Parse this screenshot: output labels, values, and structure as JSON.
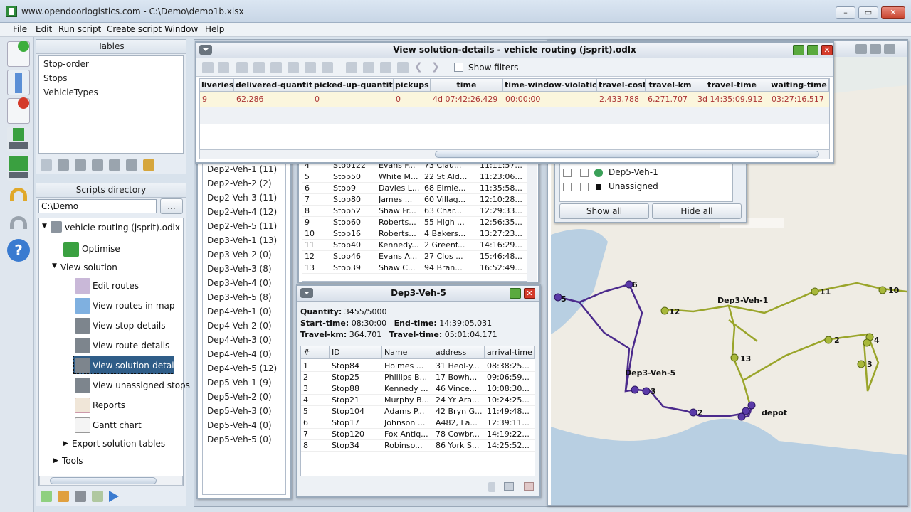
{
  "window": {
    "title": "www.opendoorlogistics.com - C:\\Demo\\demo1b.xlsx",
    "min": "–",
    "max": "▭",
    "close": "✕"
  },
  "menu": [
    "File",
    "Edit",
    "Run script",
    "Create script",
    "Window",
    "Help"
  ],
  "tables_panel": {
    "title": "Tables",
    "items": [
      "Stop-order",
      "Stops",
      "VehicleTypes"
    ]
  },
  "scripts_panel": {
    "title": "Scripts directory",
    "path": "C:\\Demo",
    "browse": "...",
    "root": "vehicle routing (jsprit).odlx",
    "optimise": "Optimise",
    "view_solution": "View solution",
    "items": [
      "Edit routes",
      "View routes in map",
      "View stop-details",
      "View route-details",
      "View solution-details",
      "View unassigned stops",
      "Reports",
      "Gantt chart"
    ],
    "export": "Export solution tables",
    "tools": "Tools"
  },
  "solution_details": {
    "title": "View solution-details - vehicle routing (jsprit).odlx",
    "show_filters": "Show filters",
    "columns": [
      "liveries",
      "delivered-quantity",
      "picked-up-quantity",
      "pickups",
      "time",
      "time-window-violation",
      "travel-cost",
      "travel-km",
      "travel-time",
      "waiting-time"
    ],
    "row": [
      "9",
      "62,286",
      "0",
      "0",
      "4d 07:42:26.429",
      "00:00:00",
      "2,433.788",
      "6,271.707",
      "3d 14:35:09.912",
      "03:27:16.517"
    ]
  },
  "routes_list": [
    "Dep2-Veh-1 (11)",
    "Dep2-Veh-2 (2)",
    "Dep2-Veh-3 (11)",
    "Dep2-Veh-4 (12)",
    "Dep2-Veh-5 (11)",
    "Dep3-Veh-1 (13)",
    "Dep3-Veh-2 (0)",
    "Dep3-Veh-3 (8)",
    "Dep3-Veh-4 (0)",
    "Dep3-Veh-5 (8)",
    "Dep4-Veh-1 (0)",
    "Dep4-Veh-2 (0)",
    "Dep4-Veh-3 (0)",
    "Dep4-Veh-4 (0)",
    "Dep4-Veh-5 (12)",
    "Dep5-Veh-1 (9)",
    "Dep5-Veh-2 (0)",
    "Dep5-Veh-3 (0)",
    "Dep5-Veh-4 (0)",
    "Dep5-Veh-5 (0)"
  ],
  "stops_table_bg": [
    [
      "4",
      "Stop122",
      "Evans F...",
      "73 Clau...",
      "11:11:57..."
    ],
    [
      "5",
      "Stop50",
      "White M...",
      "22 St Ald...",
      "11:23:06..."
    ],
    [
      "6",
      "Stop9",
      "Davies L...",
      "68 Elmle...",
      "11:35:58..."
    ],
    [
      "7",
      "Stop80",
      "James ...",
      "60 Villag...",
      "12:10:28..."
    ],
    [
      "8",
      "Stop52",
      "Shaw Fr...",
      "63 Char...",
      "12:29:33..."
    ],
    [
      "9",
      "Stop60",
      "Roberts...",
      "55 High ...",
      "12:56:35..."
    ],
    [
      "10",
      "Stop16",
      "Roberts...",
      "4 Bakers...",
      "13:27:23..."
    ],
    [
      "11",
      "Stop40",
      "Kennedy...",
      "2 Greenf...",
      "14:16:29..."
    ],
    [
      "12",
      "Stop46",
      "Evans A...",
      "27 Clos ...",
      "15:46:48..."
    ],
    [
      "13",
      "Stop39",
      "Shaw C...",
      "94 Bran...",
      "16:52:49..."
    ]
  ],
  "vehicle_window": {
    "title": "Dep3-Veh-5",
    "quantity_label": "Quantity:",
    "quantity": "3455/5000",
    "start_label": "Start-time:",
    "start": "08:30:00",
    "end_label": "End-time:",
    "end": "14:39:05.031",
    "km_label": "Travel-km:",
    "km": "364.701",
    "tt_label": "Travel-time:",
    "tt": "05:01:04.171",
    "columns": [
      "#",
      "ID",
      "Name",
      "address",
      "arrival-time"
    ],
    "rows": [
      [
        "1",
        "Stop84",
        "Holmes ...",
        "31 Heol-y...",
        "08:38:25..."
      ],
      [
        "2",
        "Stop25",
        "Phillips B...",
        "17 Bowh...",
        "09:06:59..."
      ],
      [
        "3",
        "Stop88",
        "Kennedy ...",
        "46 Vince...",
        "10:08:30..."
      ],
      [
        "4",
        "Stop21",
        "Murphy B...",
        "24 Yr Ara...",
        "10:24:25..."
      ],
      [
        "5",
        "Stop104",
        "Adams P...",
        "42 Bryn G...",
        "11:49:48..."
      ],
      [
        "6",
        "Stop17",
        "Johnson ...",
        "A482, La...",
        "12:39:11..."
      ],
      [
        "7",
        "Stop120",
        "Fox Antiq...",
        "78 Cowbr...",
        "14:19:22..."
      ],
      [
        "8",
        "Stop34",
        "Robinso...",
        "86 York S...",
        "14:25:52..."
      ]
    ]
  },
  "legend": {
    "items": [
      "Dep5-Veh-1",
      "Unassigned"
    ],
    "show_all": "Show all",
    "hide_all": "Hide all"
  },
  "map_labels": {
    "depot": "depot",
    "route1": "Dep3-Veh-1",
    "route5": "Dep3-Veh-5",
    "n5": "5",
    "n6": "6",
    "n2": "2",
    "n3": "3",
    "n12": "12",
    "n11": "11",
    "n10": "10",
    "n13": "13",
    "n4": "4",
    "n2b": "2",
    "n3b": "3"
  },
  "colors": {
    "purple": "#4b2a8c",
    "olive": "#9aa52a",
    "highlight": "#2f5d88"
  }
}
